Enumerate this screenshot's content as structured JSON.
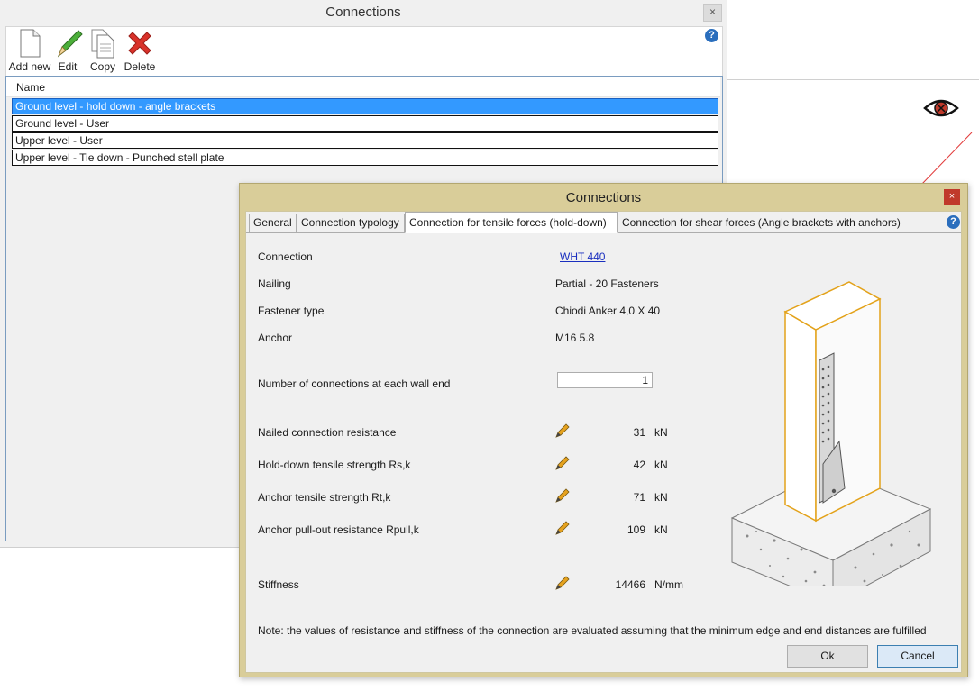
{
  "main_window": {
    "title": "Connections",
    "close_label": "×",
    "help_label": "?",
    "toolbar": [
      {
        "label": "Add new",
        "icon": "new-document-icon"
      },
      {
        "label": "Edit",
        "icon": "pencil-icon"
      },
      {
        "label": "Copy",
        "icon": "copy-icon"
      },
      {
        "label": "Delete",
        "icon": "delete-x-icon"
      }
    ],
    "list_header": "Name",
    "rows": [
      "Ground level - hold down - angle brackets",
      "Ground level - User",
      "Upper level - User",
      "Upper level - Tie down - Punched stell plate"
    ],
    "selected_row": 0
  },
  "dialog": {
    "title": "Connections",
    "close_label": "×",
    "help_label": "?",
    "tabs": [
      "General",
      "Connection typology",
      "Connection for tensile forces (hold-down)",
      "Connection for shear forces (Angle brackets with anchors)"
    ],
    "active_tab": 2,
    "fields": {
      "connection_label": "Connection",
      "connection_value": "WHT 440",
      "nailing_label": "Nailing",
      "nailing_value": "Partial - 20 Fasteners",
      "fastener_label": "Fastener type",
      "fastener_value": "Chiodi Anker 4,0 X 40",
      "anchor_label": "Anchor",
      "anchor_value": "M16 5.8",
      "num_connections_label": "Number of connections at each wall end",
      "num_connections_value": "1"
    },
    "resistances": [
      {
        "label": "Nailed connection resistance",
        "value": "31",
        "unit": "kN"
      },
      {
        "label": "Hold-down tensile strength Rs,k",
        "value": "42",
        "unit": "kN"
      },
      {
        "label": "Anchor tensile strength  Rt,k",
        "value": "71",
        "unit": "kN"
      },
      {
        "label": "Anchor pull-out resistance Rpull,k",
        "value": "109",
        "unit": "kN"
      }
    ],
    "stiffness": {
      "label": "Stiffness",
      "value": "14466",
      "unit": "N/mm"
    },
    "note": "Note: the values of resistance and stiffness of the connection are evaluated assuming that the minimum edge and end distances are fulfilled",
    "ok_label": "Ok",
    "cancel_label": "Cancel"
  },
  "colors": {
    "selection": "#3399ff",
    "dialog_frame": "#d9cd99",
    "wall_outline": "#e3a21a",
    "close_red": "#c0392b"
  }
}
